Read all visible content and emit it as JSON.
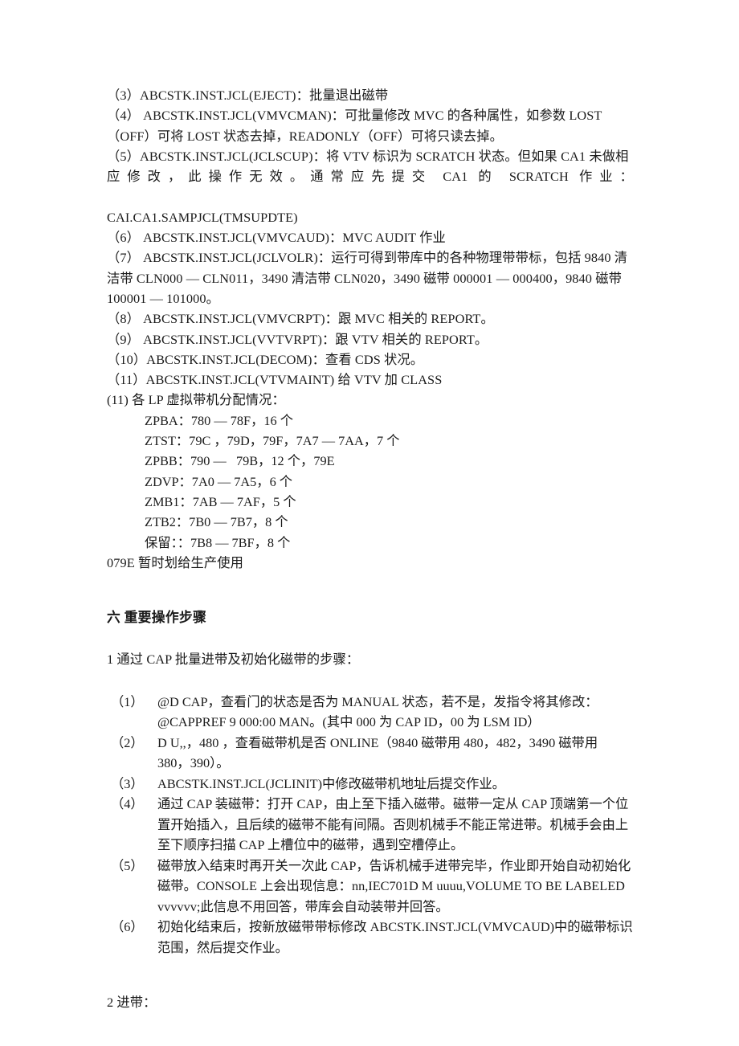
{
  "document": {
    "jcl_members": {
      "item_3": "（3）ABCSTK.INST.JCL(EJECT)：批量退出磁带",
      "item_4_line1": "（4）  ABCSTK.INST.JCL(VMVCMAN)：可批量修改 MVC 的各种属性，如参数 LOST",
      "item_4_line2": "（OFF）可将 LOST 状态去掉，READONLY（OFF）可将只读去掉。",
      "item_5_line1": "（5）ABCSTK.INST.JCL(JCLSCUP)：将 VTV 标识为 SCRATCH 状态。但如果 CA1 未做相",
      "item_5_line2": "应修改，此操作无效。通常应先提交 CA1 的 SCRATCH 作业：",
      "item_5_line3": "CAI.CA1.SAMPJCL(TMSUPDTE)",
      "item_6": "（6）  ABCSTK.INST.JCL(VMVCAUD)：MVC AUDIT 作业",
      "item_7_line1": "（7）  ABCSTK.INST.JCL(JCLVOLR)：运行可得到带库中的各种物理带带标，包括 9840 清",
      "item_7_line2": "洁带 CLN000 — CLN011，3490 清洁带 CLN020，3490 磁带 000001 — 000400，9840 磁带",
      "item_7_line3": "100001 — 101000。",
      "item_8": "（8）  ABCSTK.INST.JCL(VMVCRPT)：跟 MVC 相关的 REPORT。",
      "item_9": "（9）  ABCSTK.INST.JCL(VVTVRPT)：跟 VTV 相关的 REPORT。",
      "item_10": "（10）ABCSTK.INST.JCL(DECOM)：查看 CDS 状况。",
      "item_11": "（11）ABCSTK.INST.JCL(VTVMAINT) 给 VTV 加 CLASS",
      "item_11b": "(11) 各 LP 虚拟带机分配情况："
    },
    "lp_allocation": [
      "ZPBA：780 — 78F，16 个",
      "ZTST：79C ，79D，79F，7A7 — 7AA，7 个",
      "ZPBB：790 —   79B，12 个，79E",
      "ZDVP：7A0 — 7A5，6 个",
      "ZMB1：7AB — 7AF，5 个",
      "ZTB2：7B0 — 7B7，8 个",
      "保留：：7B8 — 7BF，8 个"
    ],
    "note_079e": "079E 暂时划给生产使用",
    "section_six": {
      "heading": "六  重要操作步骤",
      "subheading_1": "1  通过 CAP 批量进带及初始化磁带的步骤：",
      "steps": [
        {
          "marker": "（1）",
          "lines": [
            "@D   CAP，查看门的状态是否为 MANUAL 状态，若不是，发指令将其修改：",
            "@CAPPREF  9   000:00   MAN。(其中 000 为 CAP ID，00 为 LSM ID）"
          ]
        },
        {
          "marker": "（2）",
          "lines": [
            "D   U,,，480 ，查看磁带机是否 ONLINE（9840 磁带用 480，482，3490 磁带用",
            "380，390）。"
          ]
        },
        {
          "marker": "（3）",
          "lines": [
            "ABCSTK.INST.JCL(JCLINIT)中修改磁带机地址后提交作业。"
          ]
        },
        {
          "marker": "（4）",
          "lines": [
            "通过 CAP 装磁带：打开 CAP，由上至下插入磁带。磁带一定从 CAP 顶端第一个位",
            "置开始插入，且后续的磁带不能有间隔。否则机械手不能正常进带。机械手会由上",
            "至下顺序扫描 CAP 上槽位中的磁带，遇到空槽停止。"
          ]
        },
        {
          "marker": "（5）",
          "lines": [
            "磁带放入结束时再开关一次此 CAP，告诉机械手进带完毕，作业即开始自动初始化",
            "磁带。CONSOLE 上会出现信息：nn,IEC701D M uuuu,VOLUME TO BE LABELED",
            "vvvvvv;此信息不用回答，带库会自动装带并回答。"
          ]
        },
        {
          "marker": "（6）",
          "lines": [
            "初始化结束后，按新放磁带带标修改 ABCSTK.INST.JCL(VMVCAUD)中的磁带标识",
            "范围，然后提交作业。"
          ]
        }
      ],
      "subheading_2": "2  进带："
    }
  }
}
